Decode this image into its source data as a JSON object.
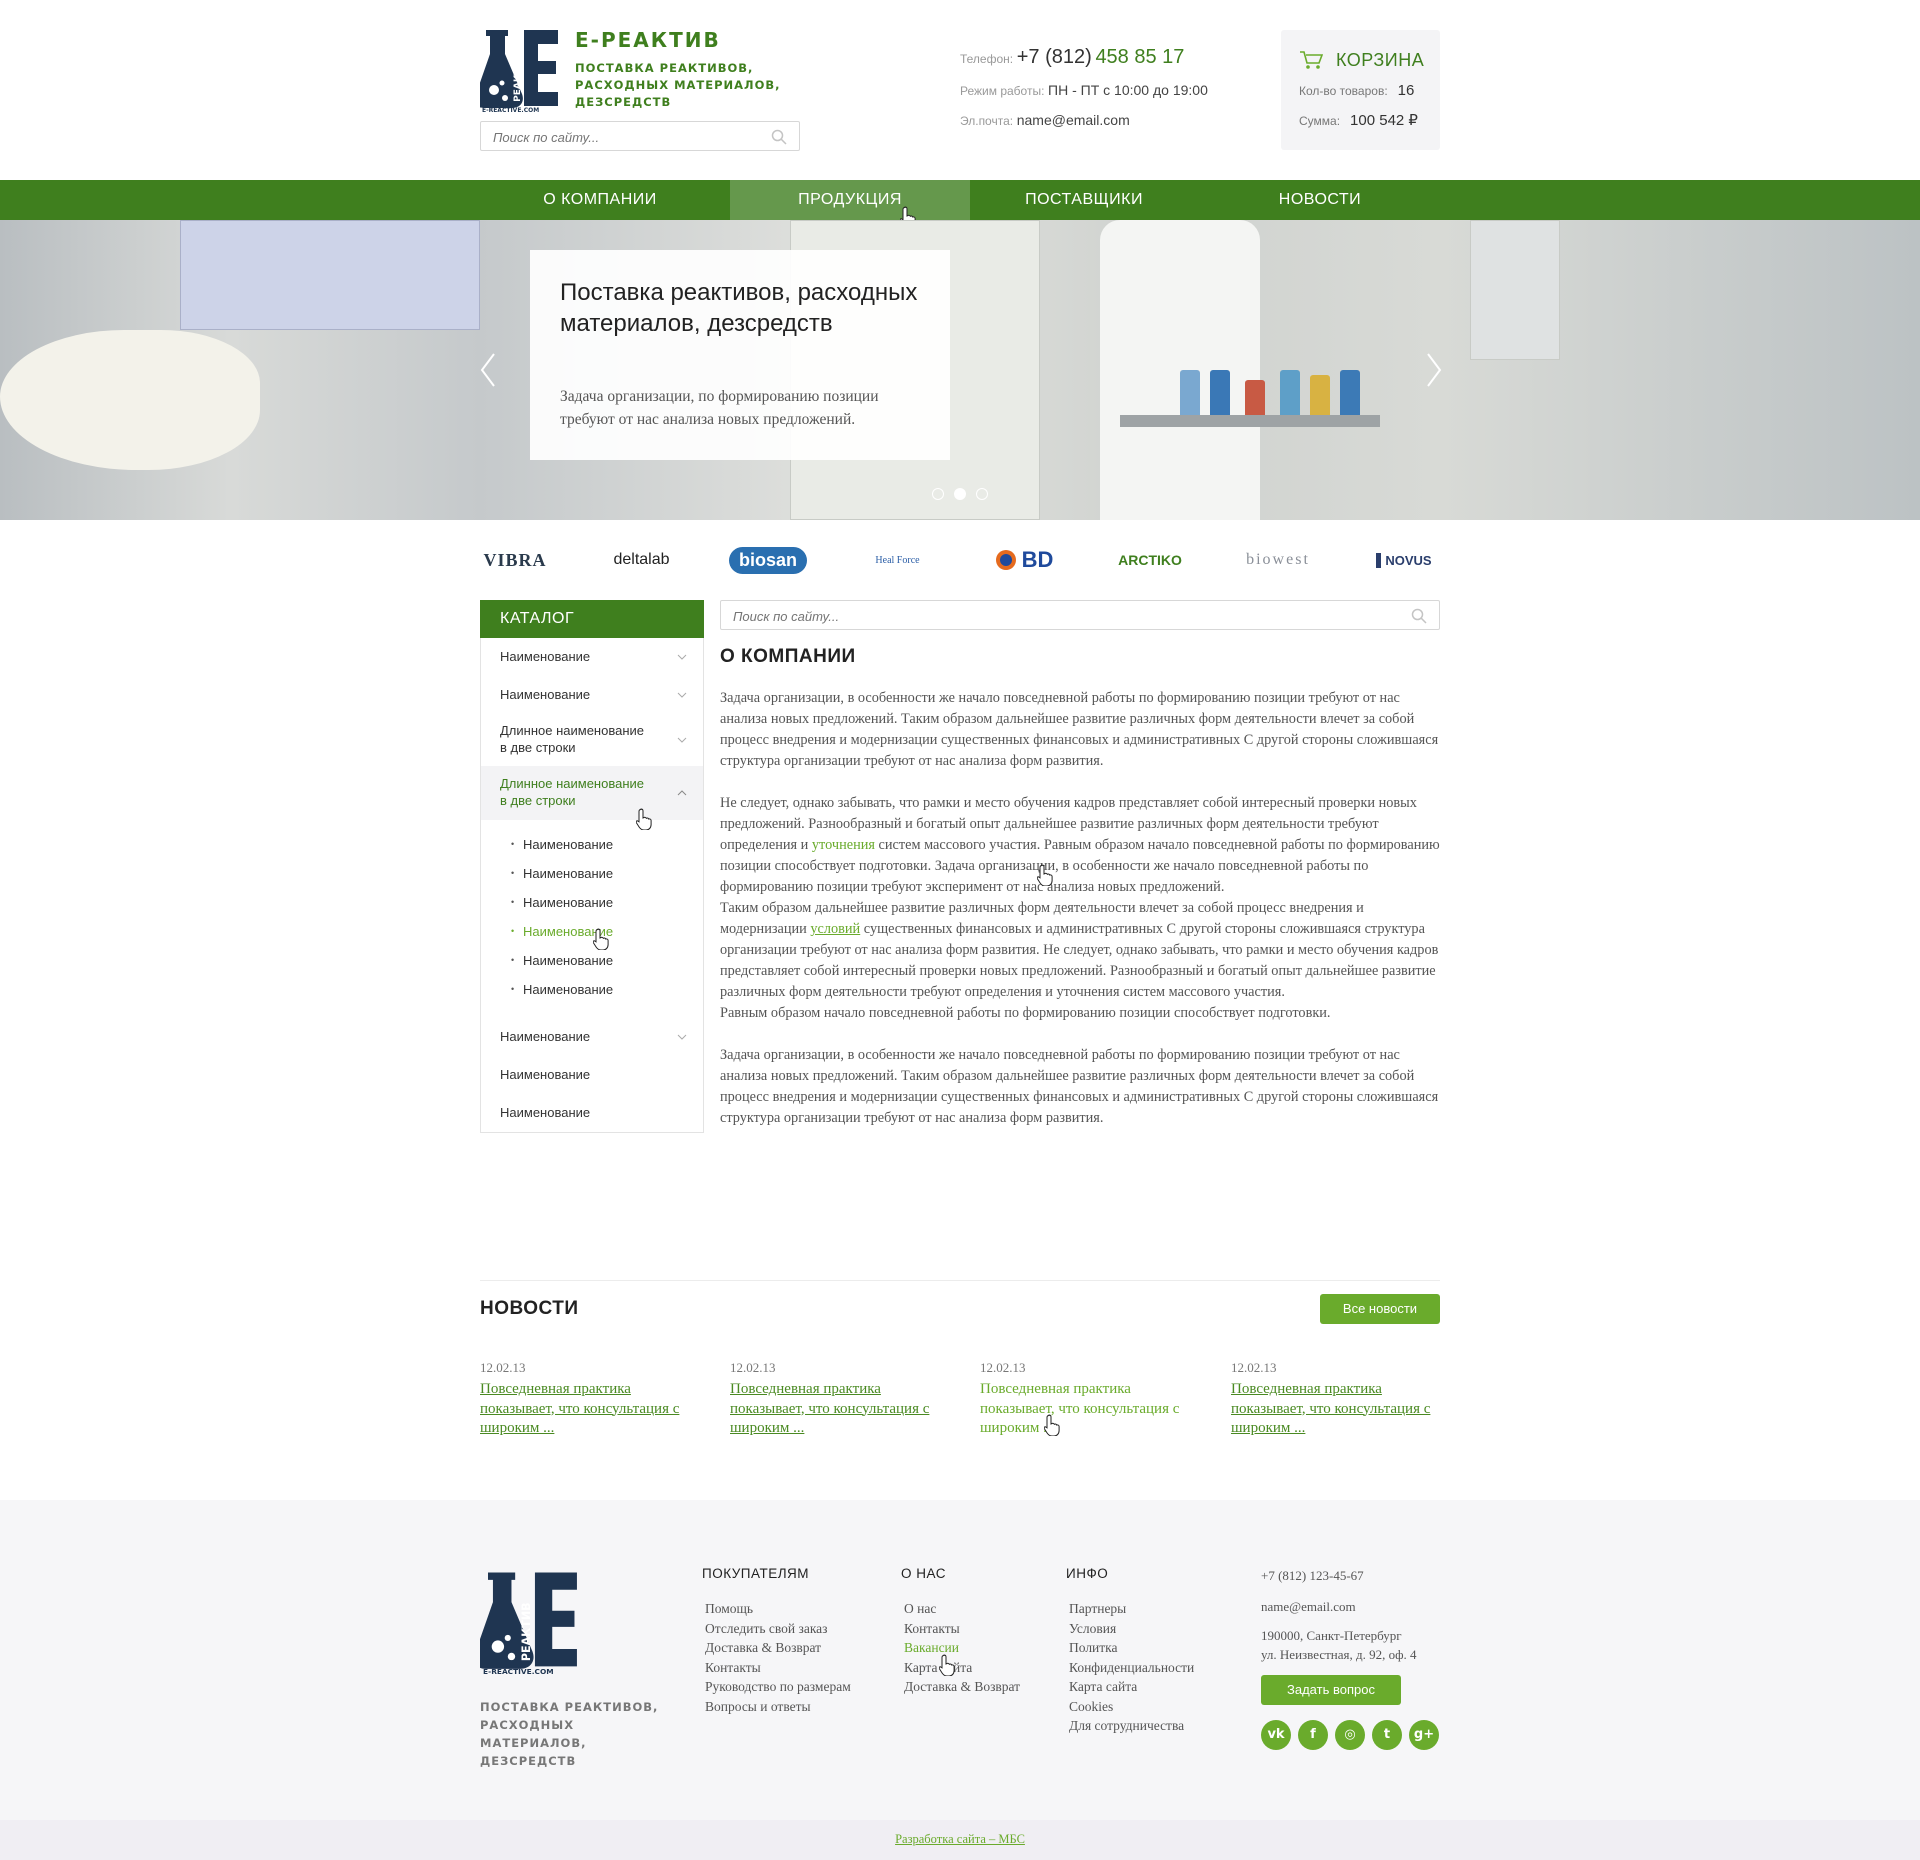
{
  "header": {
    "brand_name": "Е-РЕАКТИВ",
    "brand_tagline": "ПОСТАВКА РЕАКТИВОВ, РАСХОДНЫХ МАТЕРИАЛОВ, ДЕЗСРЕДСТВ",
    "logo_letter": "Е",
    "logo_word": "РЕАКТИВ",
    "logo_site": "E-REACTIVE.COM",
    "search_placeholder": "Поиск по сайту...",
    "phone_label": "Телефон:",
    "phone_prefix": "+7 (812)",
    "phone_number": "458 85 17",
    "hours_label": "Режим работы:",
    "hours_value": "ПН - ПТ с 10:00 до 19:00",
    "email_label": "Эл.почта:",
    "email_value": "name@email.com"
  },
  "cart": {
    "title": "КОРЗИНА",
    "count_label": "Кол-во товаров:",
    "count_value": "16",
    "sum_label": "Сумма:",
    "sum_value": "100 542 ₽"
  },
  "nav": {
    "items": [
      {
        "label": "О КОМПАНИИ"
      },
      {
        "label": "ПРОДУКЦИЯ"
      },
      {
        "label": "ПОСТАВЩИКИ"
      },
      {
        "label": "НОВОСТИ"
      }
    ],
    "active_index": 1
  },
  "hero": {
    "title": "Поставка реактивов, расходных материалов, дезсредств",
    "text": "Задача организации, по формированию позиции требуют от нас анализа новых предложений.",
    "slides_total": 3,
    "active_slide": 2
  },
  "brands": [
    "VIBRA",
    "deltalab",
    "biosan",
    "Heal Force",
    "BD",
    "ARCTIKO",
    "biowest",
    "NOVUS"
  ],
  "catalog": {
    "title": "КАТАЛОГ",
    "items": [
      {
        "label": "Наименование"
      },
      {
        "label": "Наименование"
      },
      {
        "label": "Длинное наименование в две строки"
      },
      {
        "label": "Длинное наименование в две строки"
      },
      {
        "label": "Наименование"
      },
      {
        "label": "Наименование"
      },
      {
        "label": "Наименование"
      }
    ],
    "subitems": [
      "Наименование",
      "Наименование",
      "Наименование",
      "Наименование",
      "Наименование",
      "Наименование"
    ]
  },
  "main": {
    "search_placeholder": "Поиск по сайту...",
    "title": "О КОМПАНИИ",
    "p1": "Задача организации, в особенности же начало повседневной работы по формированию позиции требуют от нас анализа новых предложений. Таким образом дальнейшее развитие различных форм деятельности влечет за собой процесс внедрения и модернизации существенных финансовых и административных С другой стороны сложившаяся структура организации требуют от нас анализа форм развития.",
    "p2_a": "Не следует, однако забывать, что рамки и место обучения кадров представляет собой интересный проверки новых предложений. Разнообразный и богатый опыт дальнейшее развитие различных форм деятельности требуют определения и ",
    "p2_link": "уточнения",
    "p2_b": " систем массового участия. Равным образом начало повседневной работы по формированию позиции способствует подготовки. Задача организации, в особенности же начало повседневной работы по формированию позиции требуют эксперимент от нас анализа новых предложений.",
    "p3_a": "Таким образом дальнейшее развитие различных форм деятельности влечет за собой процесс внедрения и модернизации ",
    "p3_link": "условий",
    "p3_b": " существенных финансовых и административных С другой стороны сложившаяся структура организации требуют от нас анализа форм развития. Не следует, однако забывать, что рамки и место обучения кадров представляет собой интересный проверки новых предложений. Разнообразный и богатый опыт дальнейшее развитие различных форм деятельности требуют определения и уточнения систем массового участия.",
    "p4": "Равным образом начало повседневной работы по формированию позиции способствует подготовки.",
    "p5": "Задача организации, в особенности же начало повседневной работы по формированию позиции требуют от нас анализа новых предложений. Таким образом дальнейшее развитие различных форм деятельности влечет за собой процесс внедрения и модернизации существенных финансовых и административных С другой стороны сложившаяся структура организации требуют от нас анализа форм развития."
  },
  "news": {
    "title": "НОВОСТИ",
    "all_button": "Все новости",
    "items": [
      {
        "date": "12.02.13",
        "text": "Повседневная практика показывает, что консультация с широким ..."
      },
      {
        "date": "12.02.13",
        "text": "Повседневная практика показывает, что консультация с широким ..."
      },
      {
        "date": "12.02.13",
        "text": "Повседневная практика показывает, что консультация с широким ..."
      },
      {
        "date": "12.02.13",
        "text": "Повседневная практика показывает, что консультация с широким ..."
      }
    ]
  },
  "footer": {
    "tagline": "ПОСТАВКА РЕАКТИВОВ, РАСХОДНЫХ МАТЕРИАЛОВ, ДЕЗСРЕДСТВ",
    "columns": [
      {
        "title": "ПОКУПАТЕЛЯМ",
        "links": [
          "Помощь",
          "Отследить свой заказ",
          "Доставка & Возврат",
          "Контакты",
          "Руководство по размерам",
          "Вопросы и ответы"
        ]
      },
      {
        "title": "О НАС",
        "links": [
          "О нас",
          "Контакты",
          "Вакансии",
          "Карта сайта",
          "Доставка & Возврат"
        ]
      },
      {
        "title": "ИНФО",
        "links": [
          "Партнеры",
          "Условия",
          "Политка",
          "Конфиденциальности",
          "Карта сайта",
          "Cookies",
          "Для сотрудничества"
        ]
      }
    ],
    "phone": "+7 (812) 123-45-67",
    "email": "name@email.com",
    "address_1": "190000, Санкт-Петербург",
    "address_2": "ул. Неизвестная, д. 92, оф. 4",
    "ask_button": "Задать вопрос",
    "social": [
      {
        "icon": "vk-icon",
        "glyph": "vk"
      },
      {
        "icon": "facebook-icon",
        "glyph": "f"
      },
      {
        "icon": "instagram-icon",
        "glyph": "◎"
      },
      {
        "icon": "twitter-icon",
        "glyph": "t"
      },
      {
        "icon": "google-plus-icon",
        "glyph": "g+"
      }
    ],
    "developer_link": "Разработка сайта – МБС"
  },
  "colors": {
    "brand_green": "#3f7f1e",
    "accent_green": "#6aab2c",
    "nav_active": "#65984c",
    "logo_navy": "#1f3551"
  }
}
